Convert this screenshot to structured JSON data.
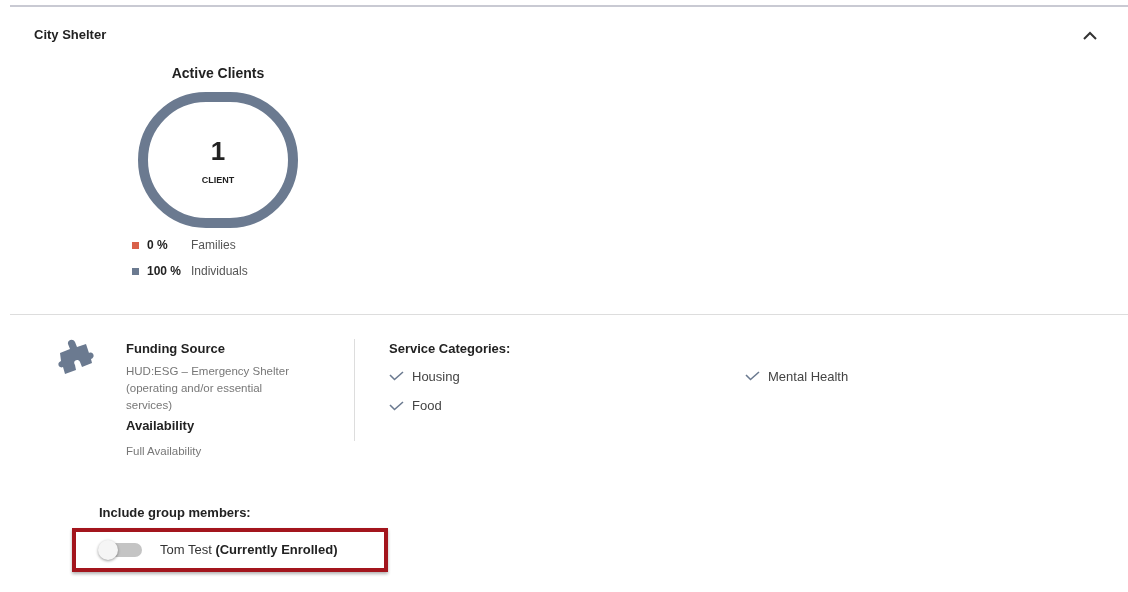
{
  "section": {
    "title": "City Shelter",
    "expanded": true
  },
  "active_clients": {
    "title": "Active Clients",
    "count": "1",
    "unit": "CLIENT",
    "legend": [
      {
        "percent": "0 %",
        "label": "Families",
        "color": "#d9614a"
      },
      {
        "percent": "100 %",
        "label": "Individuals",
        "color": "#6b7a90"
      }
    ]
  },
  "funding": {
    "title": "Funding Source",
    "text": "HUD:ESG – Emergency Shelter (operating and/or essential services)"
  },
  "availability": {
    "title": "Availability",
    "text": "Full Availability"
  },
  "service_categories": {
    "title": "Service Categories:",
    "items": [
      "Housing",
      "Mental Health",
      "Food"
    ]
  },
  "group_members": {
    "title": "Include group members:",
    "members": [
      {
        "name": "Tom Test",
        "status": "(Currently Enrolled)",
        "on": false
      }
    ]
  }
}
